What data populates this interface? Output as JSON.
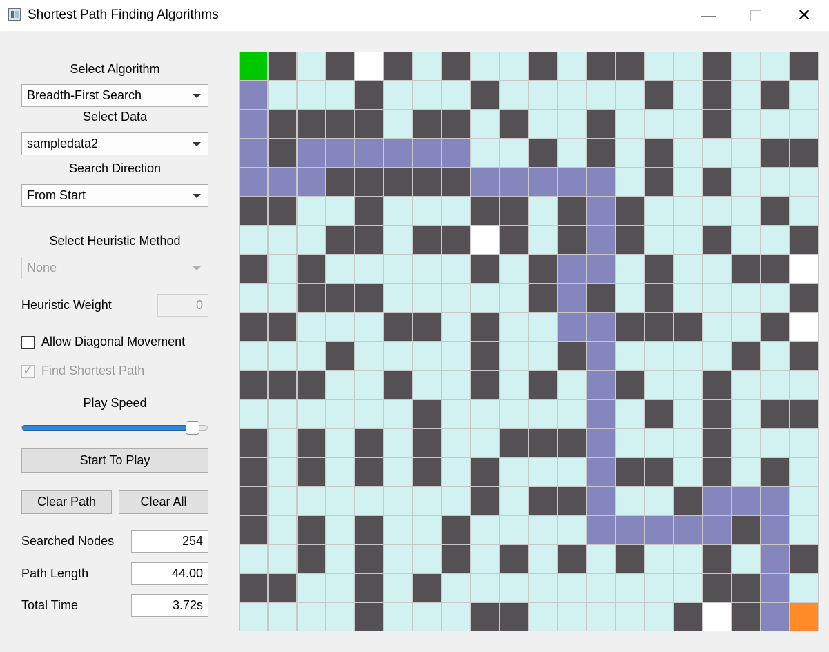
{
  "window": {
    "title": "Shortest Path Finding Algorithms",
    "buttons": {
      "minimize": "—",
      "close": "✕"
    }
  },
  "controls": {
    "select_algorithm_label": "Select Algorithm",
    "algorithm_value": "Breadth-First Search",
    "select_data_label": "Select Data",
    "data_value": "sampledata2",
    "search_direction_label": "Search Direction",
    "direction_value": "From Start",
    "heuristic_method_label": "Select Heuristic Method",
    "heuristic_method_value": "None",
    "heuristic_weight_label": "Heuristic Weight",
    "heuristic_weight_value": "0",
    "allow_diagonal_label": "Allow Diagonal Movement",
    "allow_diagonal_checked": false,
    "find_shortest_label": "Find Shortest Path",
    "find_shortest_checked": true,
    "play_speed_label": "Play Speed",
    "play_speed_fraction": 0.95,
    "start_button": "Start To Play",
    "clear_path_button": "Clear Path",
    "clear_all_button": "Clear All"
  },
  "stats": {
    "searched_nodes_label": "Searched Nodes",
    "searched_nodes_value": "254",
    "path_length_label": "Path Length",
    "path_length_value": "44.00",
    "total_time_label": "Total Time",
    "total_time_value": "3.72s"
  },
  "grid": {
    "legend": {
      "S": "start",
      "E": "end",
      "W": "wall",
      "P": "path",
      "O": "open",
      "U": "unvisited"
    },
    "colors": {
      "start": "#00c800",
      "end": "#ff8c28",
      "wall": "#545054",
      "path": "#8686be",
      "open": "#d2f2f2",
      "unvisited": "#ffffff"
    },
    "rows": [
      "SWOWUWOWOOWOWWOOWOOW",
      "POOOWOOOWOOOOOWOWOWO",
      "PWWWWOWWOWOOWOOOWOOO",
      "PWPPPPPPOOWOWOWOOOWW",
      "PPPWWWWWPPPPPOWOWOOO",
      "WWOOWOOOWWOWPWOOOOWO",
      "OOOWWOWWUWOWPWOOWOOW",
      "WOWOOOOOWOWPPOWOOWWU",
      "OOWWWOOOOOWPWOWOOOOW",
      "WWOOOWWOWOOPPWWWOOWU",
      "OOOWOOOOWOOWPOOOOWOW",
      "WWWOOWOOWOWOPWOOWOOO",
      "OOOOOOWOOOOOPOWOWOWW",
      "WOWOWOWOOWWWPOOOWOOO",
      "WOWOWOWOWOOOPWWOWOWO",
      "WOOOOOOOWOWWPOOWPPPO",
      "WOWOWOOWOOOOPPPPPWPO",
      "OOWOWOOWOWOWOWOOWOPW",
      "WWOOWOWOOOOOOOOOWWPO",
      "OOOOWOOOWWOOOOOWUWPE"
    ]
  }
}
